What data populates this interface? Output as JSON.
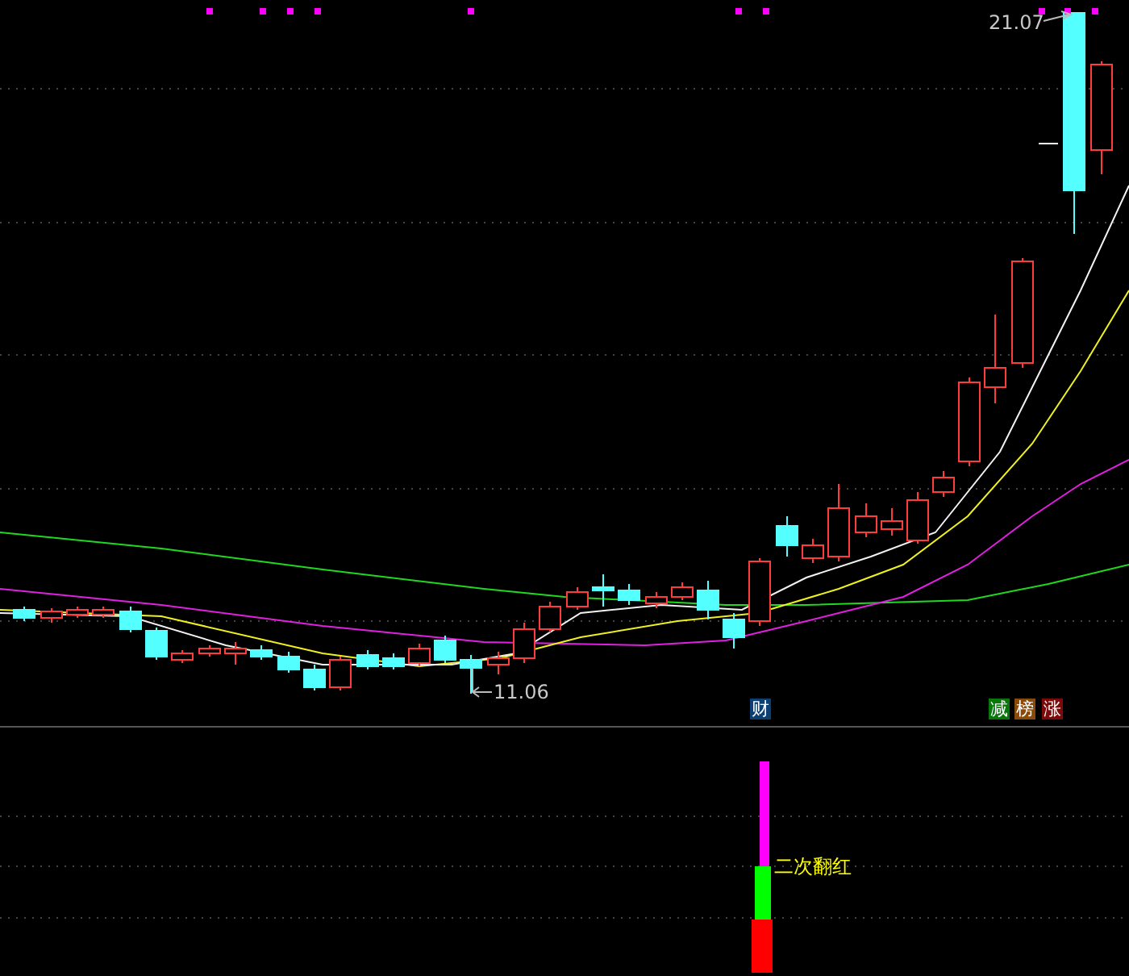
{
  "price_chart": {
    "high_label": "21.07",
    "low_label": "11.06",
    "event_badges": [
      {
        "label": "财",
        "color": "#0c3f72"
      },
      {
        "label": "减",
        "color": "#08780c"
      },
      {
        "label": "榜",
        "color": "#8a4a08"
      },
      {
        "label": "涨",
        "color": "#7c0a0a"
      }
    ]
  },
  "indicator_panel": {
    "signal_label": "二次翻红"
  }
}
